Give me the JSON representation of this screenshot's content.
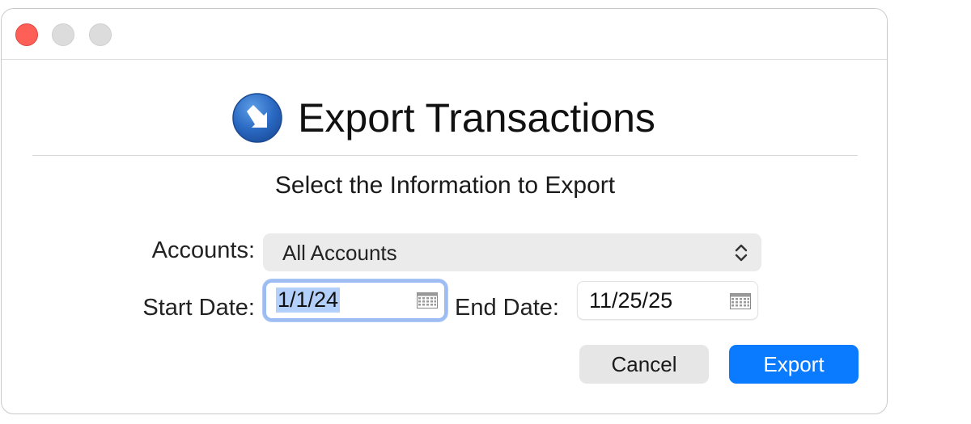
{
  "window": {
    "controls": [
      "close",
      "minimize",
      "zoom"
    ]
  },
  "header": {
    "icon": "export-arrow-icon",
    "title": "Export Transactions"
  },
  "subtitle": "Select the Information to Export",
  "form": {
    "accounts_label": "Accounts:",
    "accounts_value": "All Accounts",
    "start_label": "Start Date:",
    "start_value": "1/1/24",
    "end_label": "End Date:",
    "end_value": "11/25/25"
  },
  "buttons": {
    "cancel": "Cancel",
    "export": "Export"
  },
  "colors": {
    "accent": "#0a7aff",
    "close": "#fe5f57",
    "focus_ring": "#9dbcf3",
    "selection": "#b3d0fb"
  }
}
